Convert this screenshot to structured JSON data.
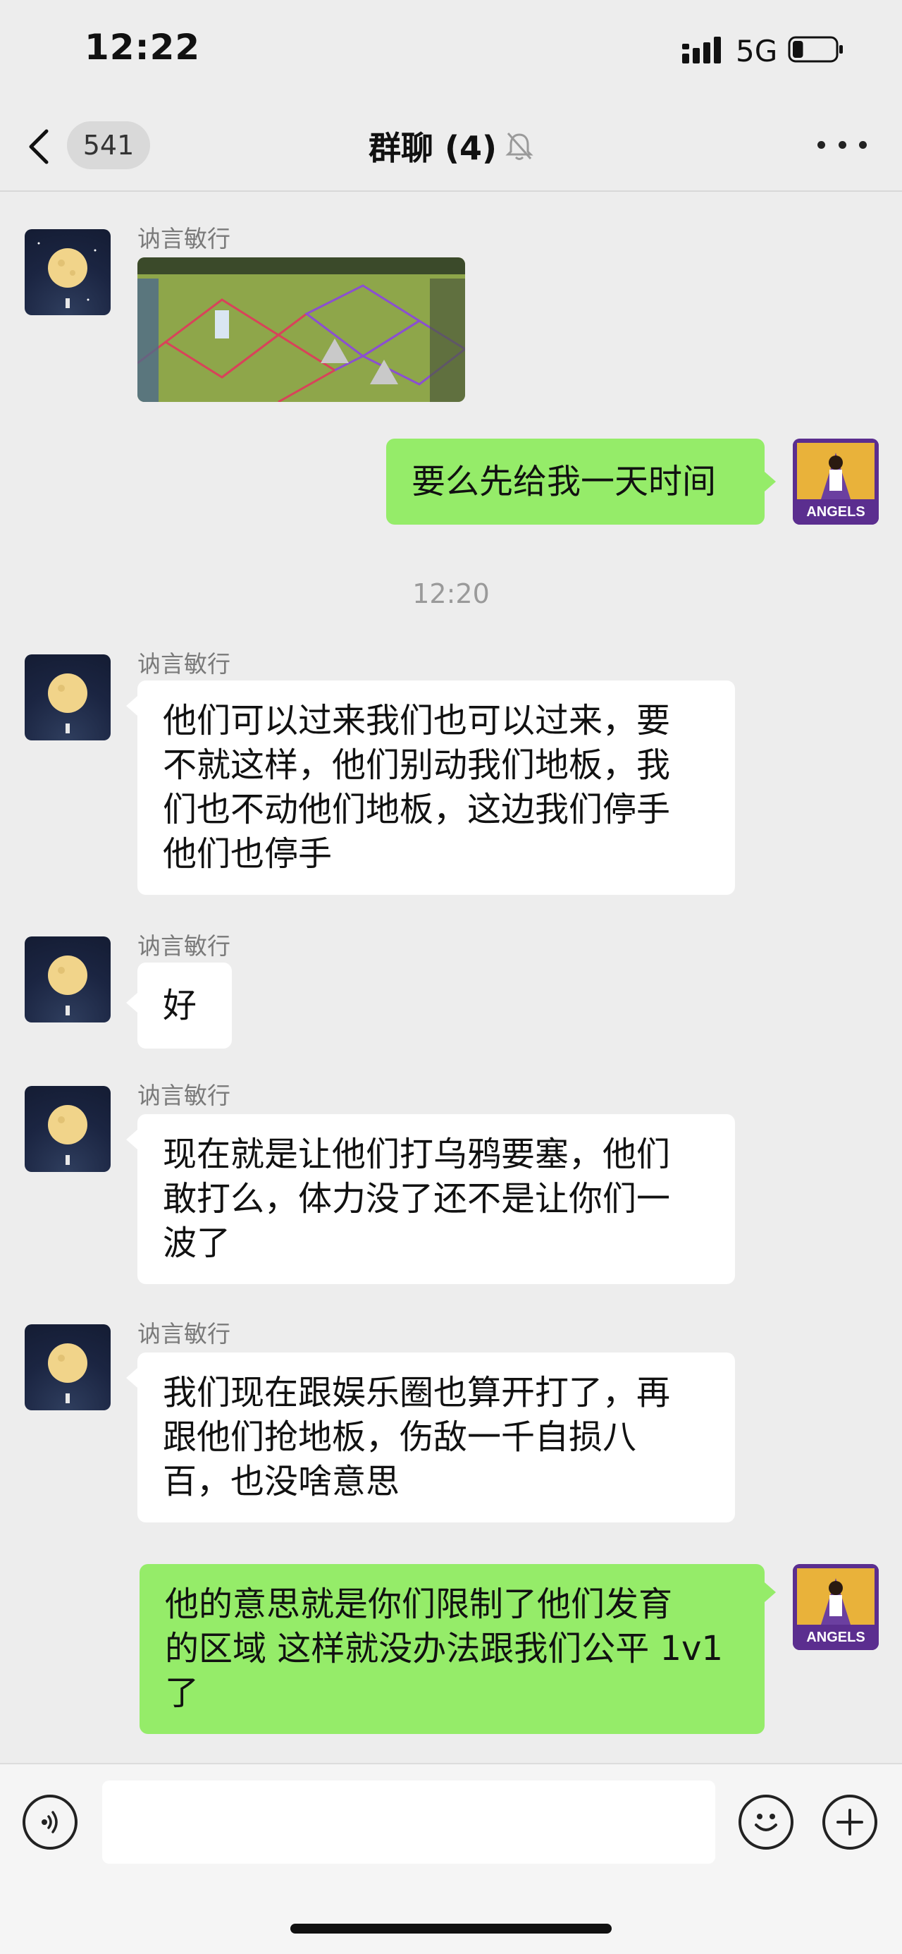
{
  "status_bar": {
    "time": "12:22",
    "network": "5G",
    "battery_level": 0.25
  },
  "header": {
    "unread_count": "541",
    "title": "群聊 (4)",
    "muted_icon": "bell-off-icon",
    "more_icon": "more-dots-icon"
  },
  "messages": [
    {
      "sender": "讷言敏行",
      "type": "image",
      "image_desc_icon": "game-map-screenshot"
    },
    {
      "type": "text-out",
      "text": "要么先给我一天时间"
    },
    {
      "type": "time",
      "text": "12:20"
    },
    {
      "sender": "讷言敏行",
      "type": "text-in",
      "lines": [
        "他们可以过来我们也可以过来，要",
        "不就这样，他们别动我们地板，我",
        "们也不动他们地板，这边我们停手",
        "他们也停手"
      ]
    },
    {
      "sender": "讷言敏行",
      "type": "text-in",
      "lines": [
        "好"
      ]
    },
    {
      "sender": "讷言敏行",
      "type": "text-in",
      "lines": [
        "现在就是让他们打乌鸦要塞，他们",
        "敢打么，体力没了还不是让你们一",
        "波了"
      ]
    },
    {
      "sender": "讷言敏行",
      "type": "text-in",
      "lines": [
        "我们现在跟娱乐圈也算开打了，再",
        "跟他们抢地板，伤敌一千自损八",
        "百，也没啥意思"
      ]
    },
    {
      "type": "text-out",
      "lines": [
        "他的意思就是你们限制了他们发育",
        "的区域 这样就没办法跟我们公平 1v1",
        "了"
      ]
    }
  ],
  "self_avatar": {
    "label": "ANGELS"
  },
  "input_bar": {
    "voice_icon": "voice-icon",
    "emoji_icon": "emoji-icon",
    "plus_icon": "plus-icon",
    "placeholder": ""
  }
}
